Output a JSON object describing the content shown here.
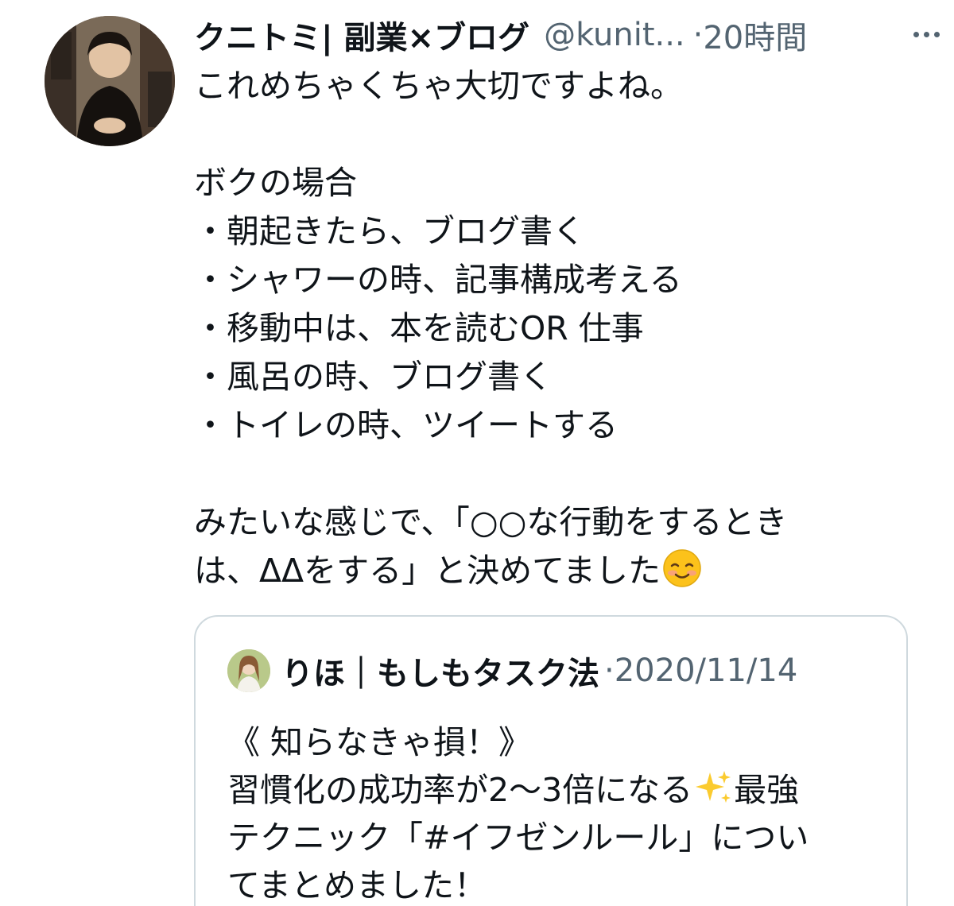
{
  "tweet": {
    "author": {
      "display_name": "クニトミ| 副業×ブログ",
      "handle": "@kunit...",
      "separator": "·",
      "time": "20時間"
    },
    "more_icon": "more-horizontal-icon",
    "body_lines": [
      "これめちゃくちゃ大切ですよね。",
      "",
      "ボクの場合",
      "・朝起きたら、ブログ書く",
      "・シャワーの時、記事構成考える",
      "・移動中は、本を読むOR 仕事",
      "・風呂の時、ブログ書く",
      "・トイレの時、ツイートする",
      "",
      "みたいな感じで、「○○な行動をするとき",
      "は、ΔΔをする」と決めてました"
    ],
    "closing_emoji": "smiling-face-icon"
  },
  "quoted_tweet": {
    "author": {
      "display_name": "りほ｜もしもタスク法",
      "separator": "·",
      "time": "2020/11/14"
    },
    "body_lines": [
      "《 知らなきゃ損！》",
      "習慣化の成功率が2〜3倍になる",
      "最強",
      "テクニック「#イフゼンルール」につい",
      "てまとめました！"
    ],
    "sparkle_emoji": "sparkles-icon"
  },
  "colors": {
    "text_primary": "#0f1419",
    "text_secondary": "#536471",
    "border": "#cfd9de"
  }
}
